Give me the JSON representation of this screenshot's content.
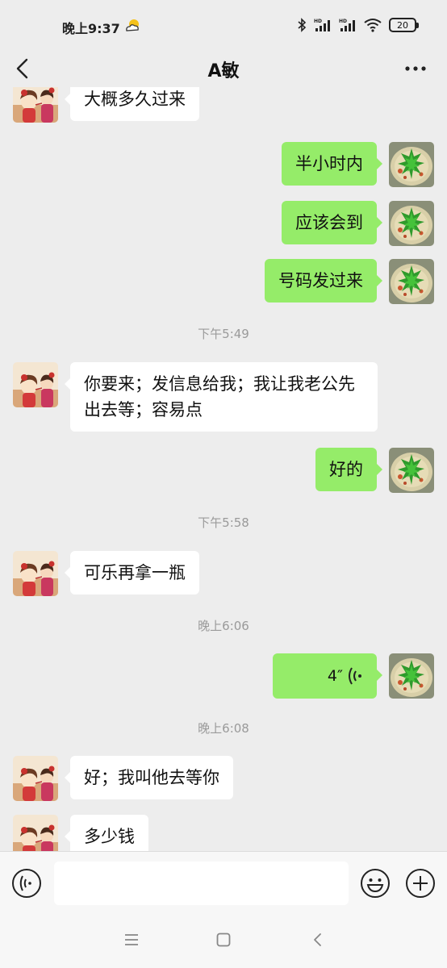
{
  "status_bar": {
    "time": "晚上9:37",
    "battery_level": "20",
    "icons": [
      "bluetooth-icon",
      "signal-hd-icon",
      "signal-hd-icon",
      "wifi-icon",
      "battery-icon"
    ]
  },
  "header": {
    "title": "A敏",
    "back_icon": "chevron-left-icon",
    "more_icon": "more-dots-icon"
  },
  "messages": [
    {
      "side": "left",
      "text": "大概多久过来"
    },
    {
      "side": "right",
      "text": "半小时内"
    },
    {
      "side": "right",
      "text": "应该会到"
    },
    {
      "side": "right",
      "text": "号码发过来"
    },
    {
      "type": "time",
      "text": "下午5:49"
    },
    {
      "side": "left",
      "text": "你要来；发信息给我；我让我老公先出去等；容易点"
    },
    {
      "side": "right",
      "text": "好的"
    },
    {
      "type": "time",
      "text": "下午5:58"
    },
    {
      "side": "left",
      "text": "可乐再拿一瓶"
    },
    {
      "type": "time",
      "text": "晚上6:06"
    },
    {
      "side": "right",
      "type": "voice",
      "duration": "4″"
    },
    {
      "type": "time",
      "text": "晚上6:08"
    },
    {
      "side": "left",
      "text": "好；我叫他去等你"
    },
    {
      "side": "left",
      "text": "多少钱"
    }
  ],
  "input_bar": {
    "voice_icon": "voice-mode-icon",
    "emoji_icon": "emoji-icon",
    "plus_icon": "plus-icon",
    "input_value": ""
  },
  "system_nav": {
    "icons": [
      "menu-icon",
      "home-icon",
      "back-icon"
    ]
  },
  "colors": {
    "sent_bubble": "#95ec69",
    "received_bubble": "#ffffff",
    "background": "#ededed"
  }
}
